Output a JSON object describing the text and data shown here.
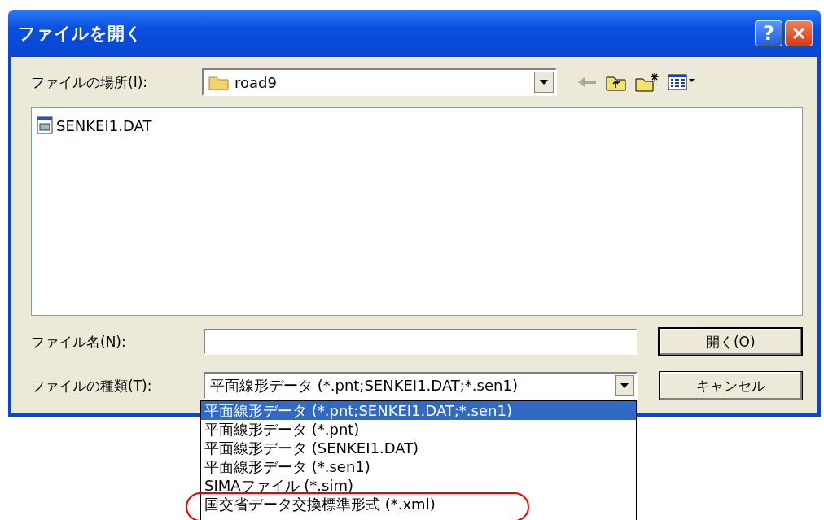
{
  "window": {
    "title": "ファイルを開く",
    "help": "?"
  },
  "location": {
    "label": "ファイルの場所(I):",
    "value": "road9"
  },
  "files": [
    {
      "name": "SENKEI1.DAT"
    }
  ],
  "file_name": {
    "label": "ファイル名(N):"
  },
  "file_type": {
    "label": "ファイルの種類(T):",
    "value": "平面線形データ (*.pnt;SENKEI1.DAT;*.sen1)"
  },
  "buttons": [
    {
      "label": "開く(O)",
      "default": true
    },
    {
      "label": "キャンセル",
      "default": false
    }
  ],
  "type_options": [
    {
      "label": "平面線形データ (*.pnt;SENKEI1.DAT;*.sen1)",
      "selected": true,
      "circled": false
    },
    {
      "label": "平面線形データ (*.pnt)",
      "selected": false,
      "circled": false
    },
    {
      "label": "平面線形データ (SENKEI1.DAT)",
      "selected": false,
      "circled": false
    },
    {
      "label": "平面線形データ (*.sen1)",
      "selected": false,
      "circled": false
    },
    {
      "label": "SIMAファイル (*.sim)",
      "selected": false,
      "circled": false
    },
    {
      "label": "国交省データ交換標準形式 (*.xml)",
      "selected": false,
      "circled": true
    }
  ]
}
